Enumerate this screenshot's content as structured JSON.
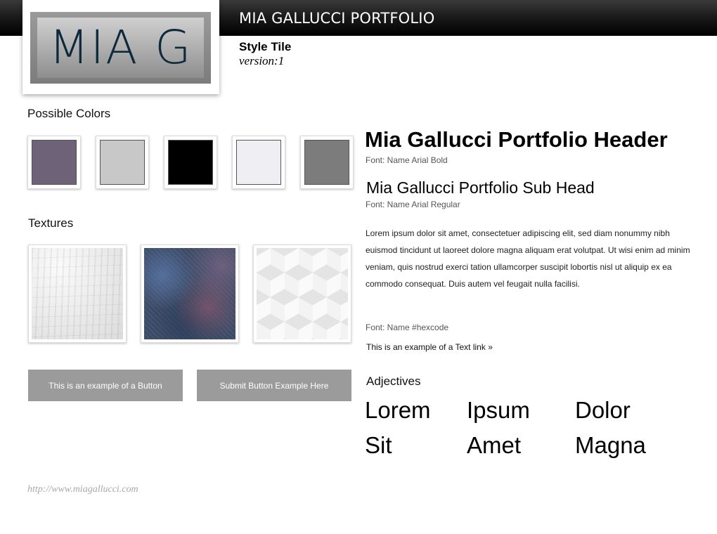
{
  "header": {
    "site_title": "MIA GALLUCCI PORTFOLIO",
    "logo_text": "MIA G",
    "tile_title": "Style Tile",
    "tile_version": "version:1"
  },
  "colors": {
    "label": "Possible Colors",
    "swatches": [
      "#6e6279",
      "#c8c8c8",
      "#000000",
      "#efeef2",
      "#7c7c7c"
    ]
  },
  "textures": {
    "label": "Textures"
  },
  "buttons": {
    "example_label": "This is an example of a Button",
    "submit_label": "Submit Button Example Here"
  },
  "footer": {
    "url": "http://www.miagallucci.com"
  },
  "typography": {
    "header_sample": "Mia Gallucci Portfolio Header",
    "header_font_note": "Font: Name Arial Bold",
    "subhead_sample": "Mia Gallucci Portfolio Sub Head",
    "subhead_font_note": "Font: Name Arial Regular",
    "body_text": "Lorem ipsum dolor sit amet, consectetuer adipiscing elit, sed diam nonummy nibh euismod tincidunt ut laoreet dolore magna aliquam erat volutpat. Ut wisi enim ad minim veniam, quis nostrud exerci tation ullamcorper suscipit lobortis nisl ut aliquip ex ea commodo consequat. Duis autem vel feugait nulla facilisi.",
    "hex_font_note": "Font: Name #hexcode",
    "text_link": "This is an example of a Text link »"
  },
  "adjectives": {
    "label": "Adjectives",
    "words": [
      "Lorem",
      "Ipsum",
      "Dolor",
      "Sit",
      "Amet",
      "Magna"
    ]
  }
}
